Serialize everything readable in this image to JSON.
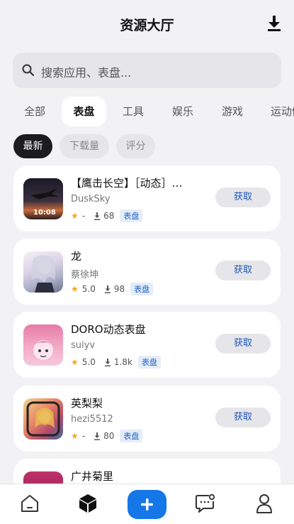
{
  "header": {
    "title": "资源大厅",
    "download_icon": "download-icon"
  },
  "search": {
    "placeholder": "搜索应用、表盘...",
    "icon": "search-icon"
  },
  "tabs": [
    {
      "label": "全部"
    },
    {
      "label": "表盘",
      "active": true
    },
    {
      "label": "工具"
    },
    {
      "label": "娱乐"
    },
    {
      "label": "游戏"
    },
    {
      "label": "运动健康"
    }
  ],
  "filters": [
    {
      "label": "最新",
      "active": true
    },
    {
      "label": "下载量"
    },
    {
      "label": "评分"
    }
  ],
  "items": [
    {
      "name": "【鹰击长空】［动态］…",
      "author": "DuskSky",
      "rating": "-",
      "downloads": "68",
      "tag": "表盘",
      "action": "获取",
      "thumb_time": "10:08"
    },
    {
      "name": "龙",
      "author": "蔡徐坤",
      "rating": "5.0",
      "downloads": "98",
      "tag": "表盘",
      "action": "获取"
    },
    {
      "name": "DORO动态表盘",
      "author": "suiyv",
      "rating": "5.0",
      "downloads": "1.8k",
      "tag": "表盘",
      "action": "获取"
    },
    {
      "name": "英梨梨",
      "author": "hezi5512",
      "rating": "-",
      "downloads": "80",
      "tag": "表盘",
      "action": "获取"
    },
    {
      "name": "广井菊里"
    }
  ],
  "bottom_nav": [
    {
      "icon": "home-icon"
    },
    {
      "icon": "cube-icon",
      "active": true
    },
    {
      "icon": "plus-icon"
    },
    {
      "icon": "message-icon"
    },
    {
      "icon": "user-icon"
    }
  ],
  "colors": {
    "accent": "#1677e8",
    "tag_text": "#1f63c9",
    "star": "#f5a623"
  }
}
